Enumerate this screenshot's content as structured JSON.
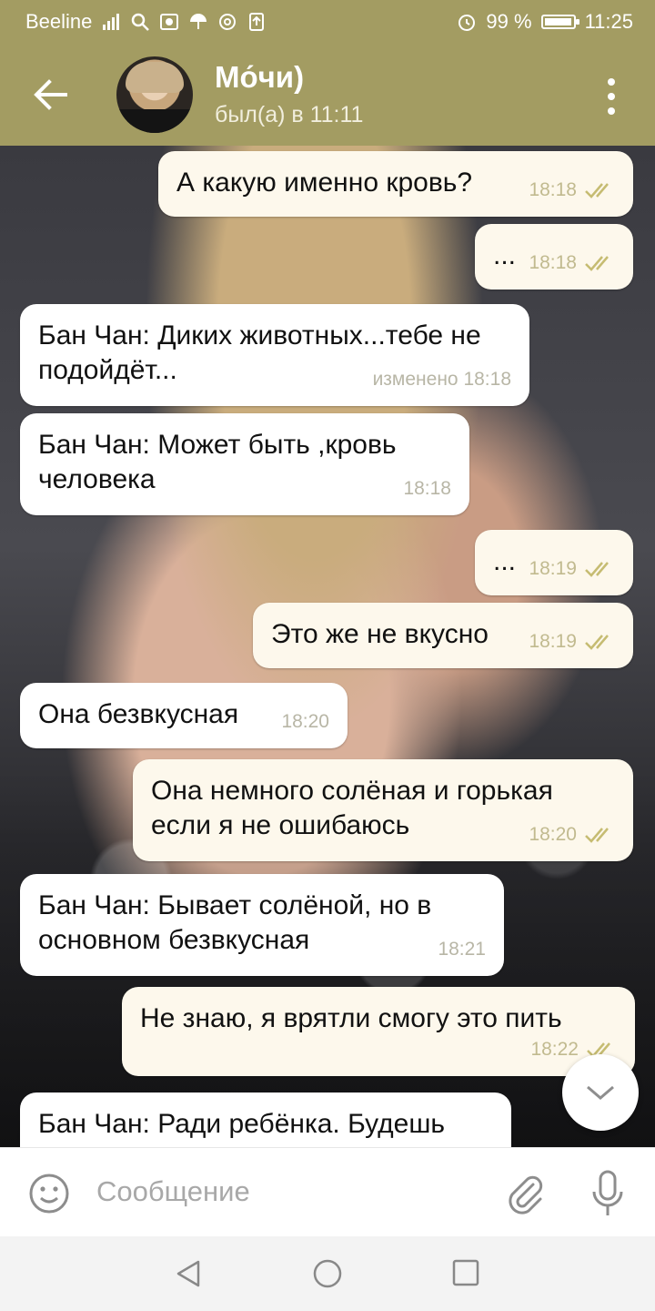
{
  "status_bar": {
    "carrier": "Beeline",
    "battery": "99 %",
    "battery_level": 0.99,
    "time": "11:25"
  },
  "header": {
    "title": "Мо́чи)",
    "subtitle": "был(а) в 11:11"
  },
  "messages": [
    {
      "side": "out",
      "text": "А какую именно кровь?",
      "time": "18:18",
      "read": true
    },
    {
      "side": "out",
      "text": "...",
      "time": "18:18",
      "read": true
    },
    {
      "side": "in",
      "text": "Бан Чан: Диких животных...тебе не подойдёт...",
      "time": "изменено 18:18"
    },
    {
      "side": "in",
      "text": "Бан Чан: Может быть ,кровь человека",
      "time": "18:18"
    },
    {
      "side": "out",
      "text": "...",
      "time": "18:19",
      "read": true
    },
    {
      "side": "out",
      "text": "Это же не вкусно",
      "time": "18:19",
      "read": true
    },
    {
      "side": "in",
      "text": "Она безвкусная",
      "time": "18:20"
    },
    {
      "side": "out",
      "text": "Она немного солёная и горькая если я не ошибаюсь",
      "time": "18:20",
      "read": true
    },
    {
      "side": "in",
      "text": "Бан Чан: Бывает солёной, но в основном безвкусная",
      "time": "18:21"
    },
    {
      "side": "out",
      "text": "Не знаю, я врятли смогу это пить",
      "time": "18:22",
      "read": true
    },
    {
      "side": "in",
      "text": "Бан Чан: Ради ребёнка. Будешь",
      "time": ""
    }
  ],
  "input": {
    "placeholder": "Сообщение"
  },
  "colors": {
    "accent": "#a39c62",
    "bubble_out": "#fdf8ec",
    "bubble_in": "#ffffff"
  }
}
